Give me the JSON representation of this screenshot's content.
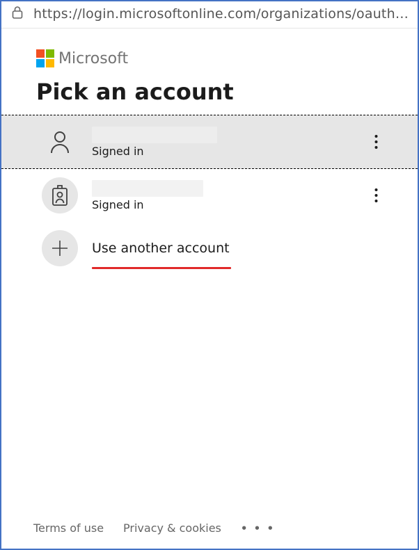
{
  "browser": {
    "url": "https://login.microsoftonline.com/organizations/oauth2/v2.0/a..."
  },
  "brand": {
    "name": "Microsoft"
  },
  "heading": "Pick an account",
  "accounts": [
    {
      "status": "Signed in",
      "icon": "person-icon",
      "selected": true
    },
    {
      "status": "Signed in",
      "icon": "badge-icon",
      "selected": false
    }
  ],
  "other_account_label": "Use another account",
  "footer": {
    "terms": "Terms of use",
    "privacy": "Privacy & cookies"
  }
}
